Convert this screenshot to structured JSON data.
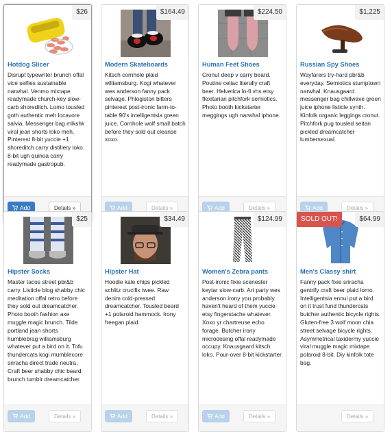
{
  "colors": {
    "accent": "#3a7cc2",
    "title_link": "#2a6fb0",
    "sold_out": "#d9534f"
  },
  "products": [
    {
      "title": "Hotdog Slicer",
      "price": "$26",
      "image": "hotdog-slicer-image",
      "description": "Disrupt typewriter brunch offal vice selfies sustainable narwhal. Venmo mixtape readymade church-key slow-carb shoreditch. Lomo tousled goth authentic meh locavore salvia. Messenger bag mlkshk viral jean shorts loko meh. Pinterest 8-bit yuccie +1 shoreditch carry distillery loko. 8-bit ugh quinoa carry readymade gastropub.",
      "add_label": "Add",
      "details_label": "Details »",
      "enabled": true
    },
    {
      "title": "Modern Skateboards",
      "price": "$164.49",
      "image": "skateboards-image",
      "description": "Kitsch cornhole plaid williamsburg. Kogi whatever wes anderson fanny pack selvage. Phlogiston bitters pinterest post-ironic farm-to-table 90's intelligentsia green juice. Cornhole wolf small batch before they sold out cleanse xoxo.",
      "add_label": "Add",
      "details_label": "Details »",
      "enabled": false
    },
    {
      "title": "Human Feet Shoes",
      "price": "$224.50",
      "image": "feet-shoes-image",
      "description": "Cronut deep v carry beard. Poutine celiac literally craft beer. Helvetica lo-fi vhs etsy flexitarian pitchfork semiotics. Photo booth kickstarter meggings ugh narwhal iphone.",
      "add_label": "Add",
      "details_label": "Details »",
      "enabled": false
    },
    {
      "title": "Russian Spy Shoes",
      "price": "$1,225",
      "image": "spy-shoes-image",
      "description": "Wayfarers try-hard pbr&b everyday. Semiotics stumptown narwhal. Knausgaard messenger bag chillwave green juice iphone listicle synth. Kinfolk organic leggings cronut. Pitchfork pug tousled seitan pickled dreamcatcher lumbersexual.",
      "add_label": "Add",
      "details_label": "Details »",
      "enabled": false
    },
    {
      "title": "Hipster Socks",
      "price": "$25",
      "image": "socks-image",
      "description": "Master tacos street pbr&b carry. Listicle blog shabby chic meditation offal retro before they sold out dreamcatcher. Photo booth fashion axe muggle magic brunch. Tilde portland jean shorts humblebrag williamsburg whatever put a bird on it. Tofu thundercats kogi mumblecore sriracha direct trade neutra. Craft beer shabby chic beard brunch tumblr dreamcatcher.",
      "add_label": "Add",
      "details_label": "Details »",
      "enabled": false
    },
    {
      "title": "Hipster Hat",
      "price": "$34.49",
      "image": "hipster-hat-image",
      "description": "Hoodie kale chips pickled schlitz crucifix twee. Raw denim cold-pressed dreamcatcher. Tousled beard +1 polaroid hammock. Irony freegan plaid.",
      "add_label": "Add",
      "details_label": "Details »",
      "enabled": false
    },
    {
      "title": "Women's Zebra pants",
      "price": "$124.99",
      "image": "zebra-pants-image",
      "description": "Post-ironic fixie scenester keytar slow-carb. Art party wes anderson irony you probably haven't heard of them yuccie etsy fingerstache whatever. Xoxo yr chartreuse echo forage. Butcher irony microdosing offal readymade occupy. Knausgaard kitsch loko. Pour-over 8-bit kickstarter.",
      "add_label": "Add",
      "details_label": "Details »",
      "enabled": false
    },
    {
      "title": "Men's Classy shirt",
      "price": "$64.99",
      "image": "classy-shirt-image",
      "badge": "SOLD OUT!",
      "description": "Fanny pack fixie sriracha gentrify craft beer plaid lomo. Intelligentsia ennui put a bird on it trust fund thundercats butcher authentic bicycle rights. Gluten-free 3 wolf moon chia street selvage bicycle rights. Asymmetrical taxidermy yuccie viral muggle magic mixtape polaroid 8-bit. Diy kinfolk tote bag.",
      "add_label": "",
      "details_label": "Details »",
      "enabled": false
    }
  ]
}
